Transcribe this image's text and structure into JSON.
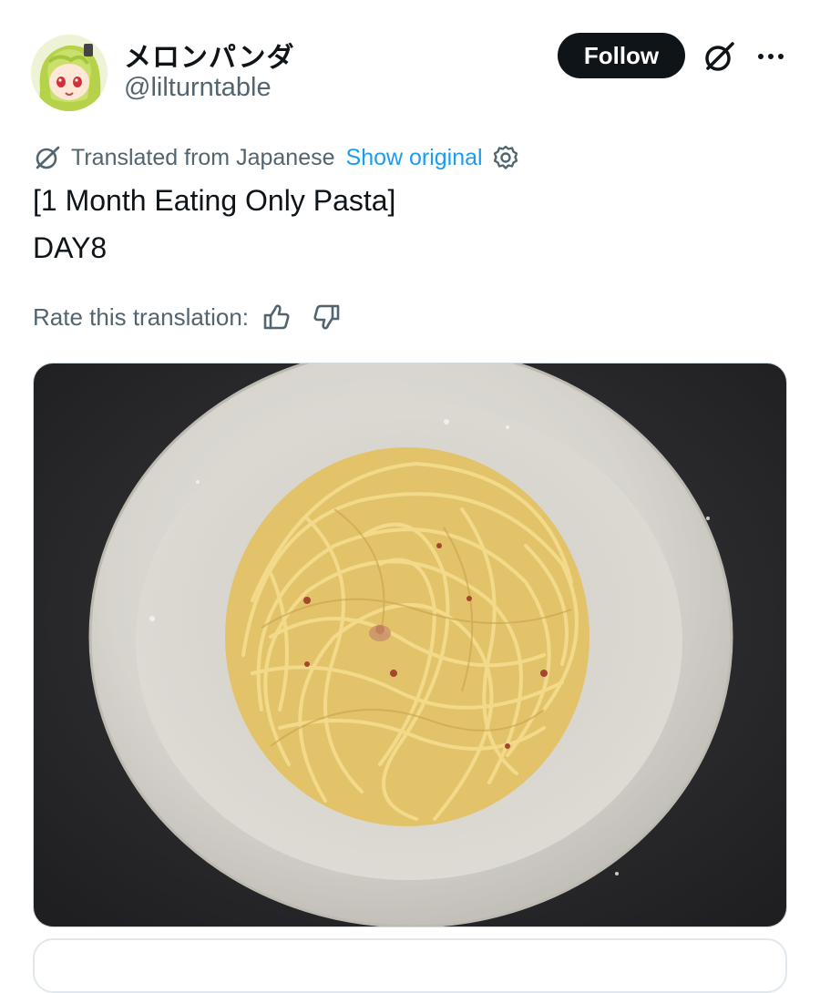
{
  "author": {
    "display_name": "メロンパンダ",
    "handle": "@lilturntable"
  },
  "actions": {
    "follow_label": "Follow",
    "grok_icon": "grok-icon",
    "more_icon": "more-horizontal-icon"
  },
  "translation": {
    "notice": "Translated from Japanese",
    "show_original": "Show original",
    "settings_icon": "gear-icon",
    "rate_label": "Rate this translation:",
    "thumbs_up_icon": "thumbs-up-icon",
    "thumbs_down_icon": "thumbs-down-icon"
  },
  "post": {
    "line1": "[1 Month Eating Only Pasta]",
    "line2": "DAY8"
  },
  "media": {
    "image_icon": "pasta-bowl-photo"
  },
  "colors": {
    "text": "#0f1419",
    "secondary": "#536471",
    "link": "#1d9bf0",
    "button_bg": "#0f1419"
  }
}
